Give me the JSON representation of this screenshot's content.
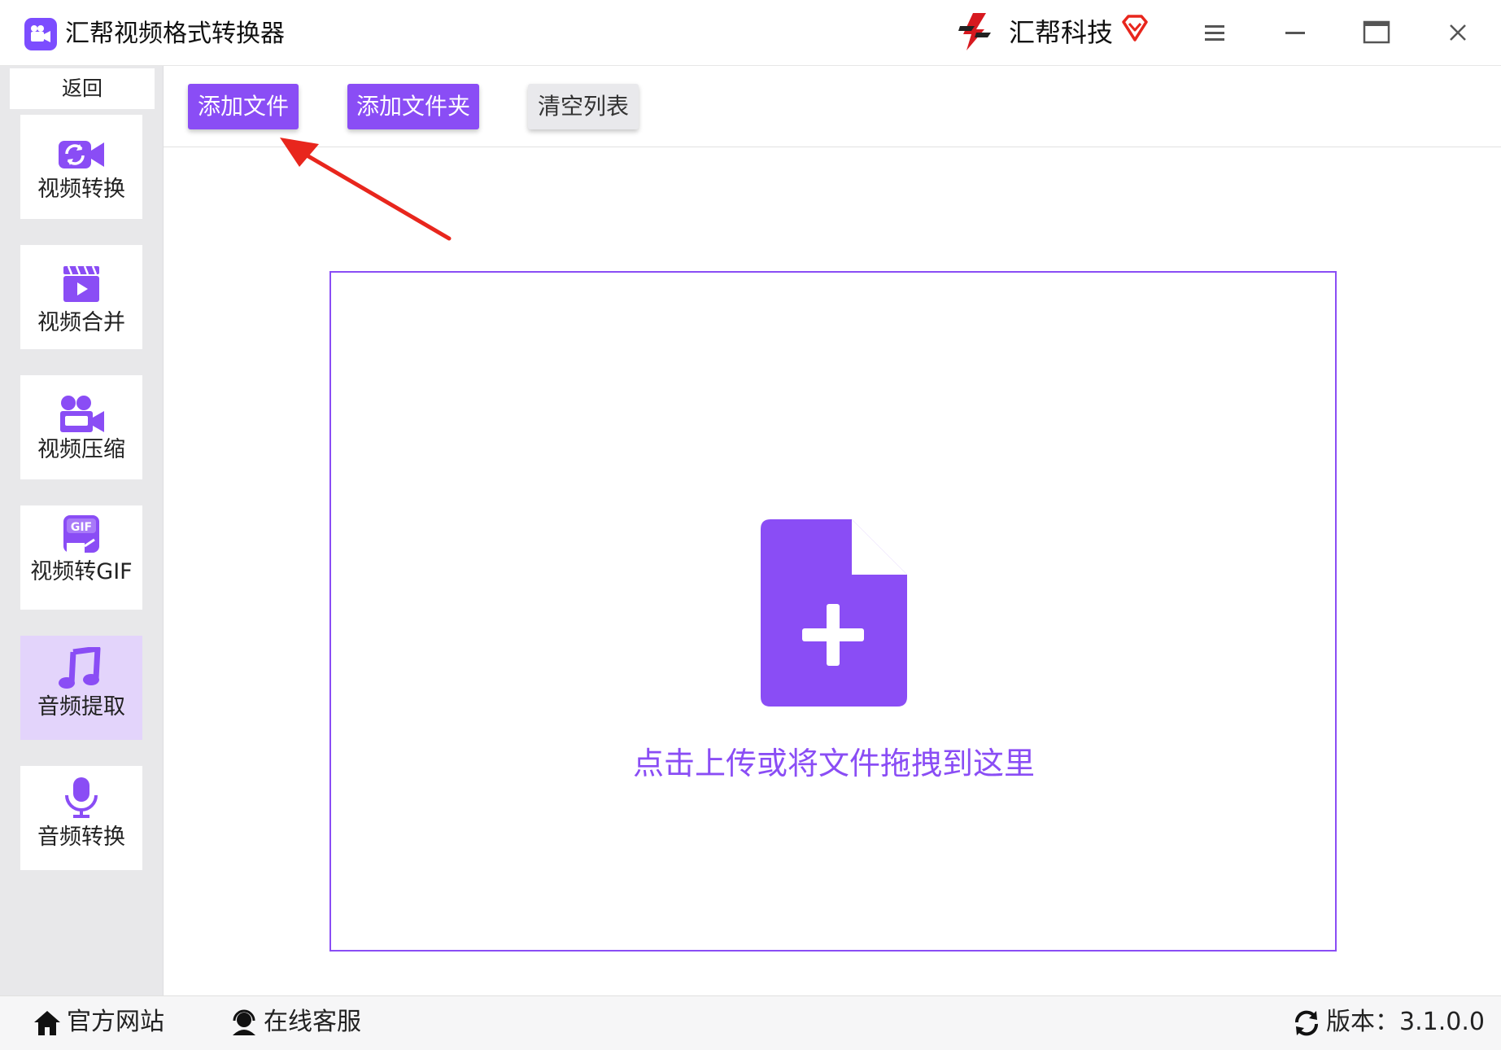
{
  "title_bar": {
    "app_icon": "video-camera-icon",
    "app_title": "汇帮视频格式转换器",
    "brand_name": "汇帮科技",
    "brand_icon": "huibang-logo-icon",
    "vip_icon": "vip-diamond-icon",
    "controls": [
      "menu-icon",
      "minimize-icon",
      "maximize-icon",
      "close-icon"
    ]
  },
  "sidebar": {
    "back_label": "返回",
    "items": [
      {
        "label": "视频转换",
        "icon": "video-convert-icon",
        "active": false
      },
      {
        "label": "视频合并",
        "icon": "video-merge-icon",
        "active": false
      },
      {
        "label": "视频压缩",
        "icon": "video-compress-icon",
        "active": false
      },
      {
        "label": "视频转GIF",
        "icon": "gif-icon",
        "active": false
      },
      {
        "label": "音频提取",
        "icon": "music-note-icon",
        "active": true
      },
      {
        "label": "音频转换",
        "icon": "microphone-icon",
        "active": false
      }
    ]
  },
  "toolbar": {
    "add_file": "添加文件",
    "add_folder": "添加文件夹",
    "clear_list": "清空列表"
  },
  "drop_zone": {
    "hint": "点击上传或将文件拖拽到这里",
    "icon": "file-add-icon"
  },
  "footer": {
    "website": "官方网站",
    "support": "在线客服",
    "version": "版本：3.1.0.0"
  },
  "colors": {
    "accent": "#8a4df5",
    "active_nav": "#e3d4fb",
    "annotation_arrow": "#e8261d"
  }
}
